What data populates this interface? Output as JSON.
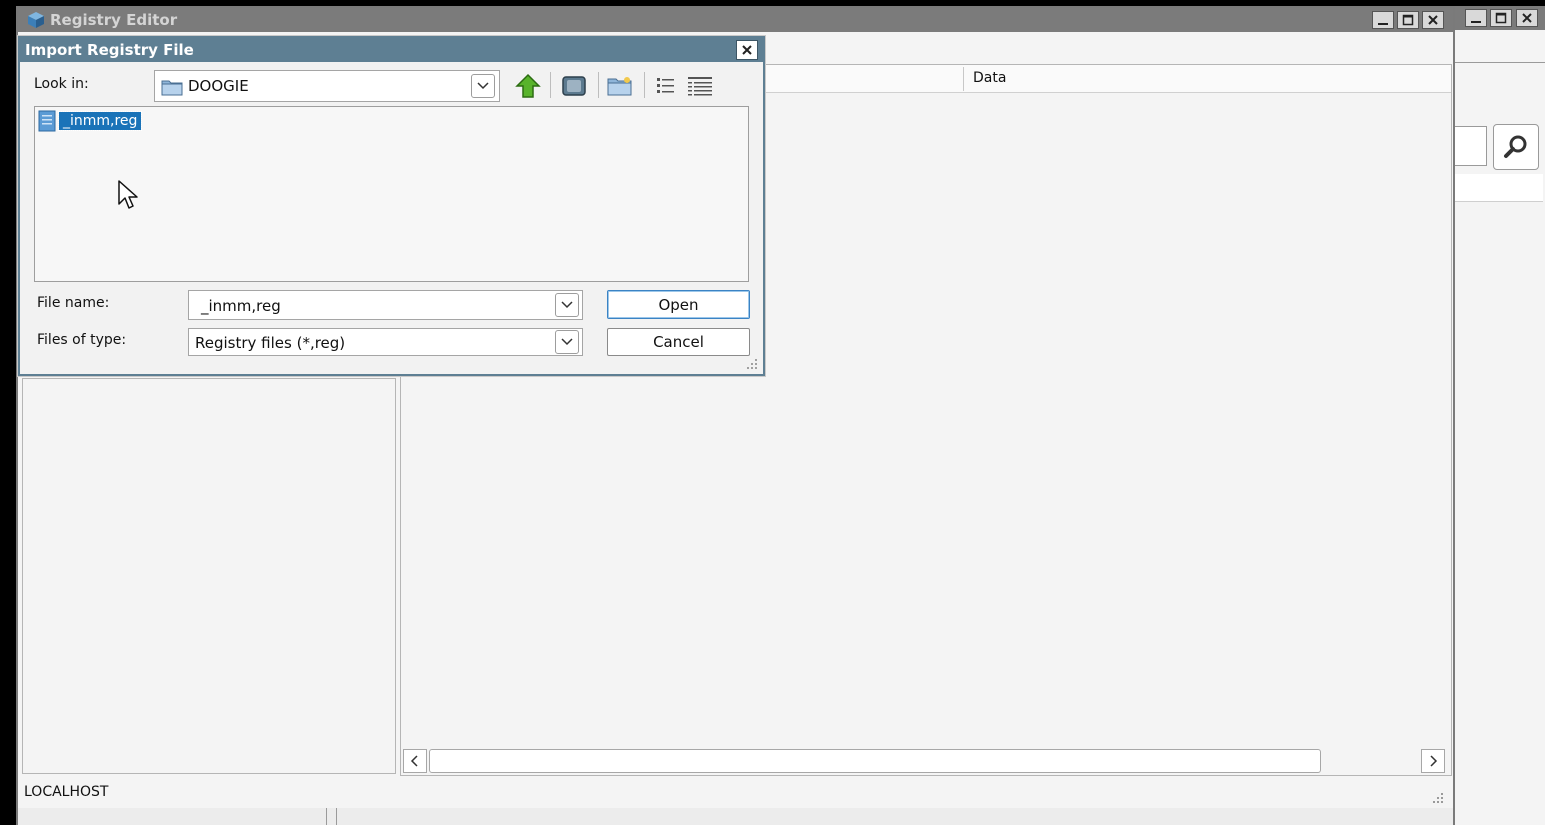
{
  "main_window": {
    "title": "Registry Editor",
    "column_header_data": "Data",
    "status_text": "LOCALHOST",
    "window_buttons": [
      "minimize",
      "maximize",
      "close"
    ]
  },
  "dialog": {
    "title": "Import Registry File",
    "look_in_label": "Look in:",
    "look_in_value": "DOOGIE",
    "toolbar_icons": [
      "up-one-level-icon",
      "desktop-icon",
      "new-folder-icon",
      "list-view-icon",
      "details-view-icon"
    ],
    "files": [
      {
        "name": "_inmm,reg",
        "selected": true
      }
    ],
    "file_name_label": "File name:",
    "file_name_value": "_inmm,reg",
    "files_of_type_label": "Files of type:",
    "files_of_type_value": "Registry files (*,reg)",
    "open_label": "Open",
    "cancel_label": "Cancel"
  },
  "colors": {
    "main_titlebar": "#7b7b7b",
    "dialog_titlebar": "#5e7f93",
    "selection": "#1a73b8",
    "window_bg": "#f4f4f4"
  }
}
